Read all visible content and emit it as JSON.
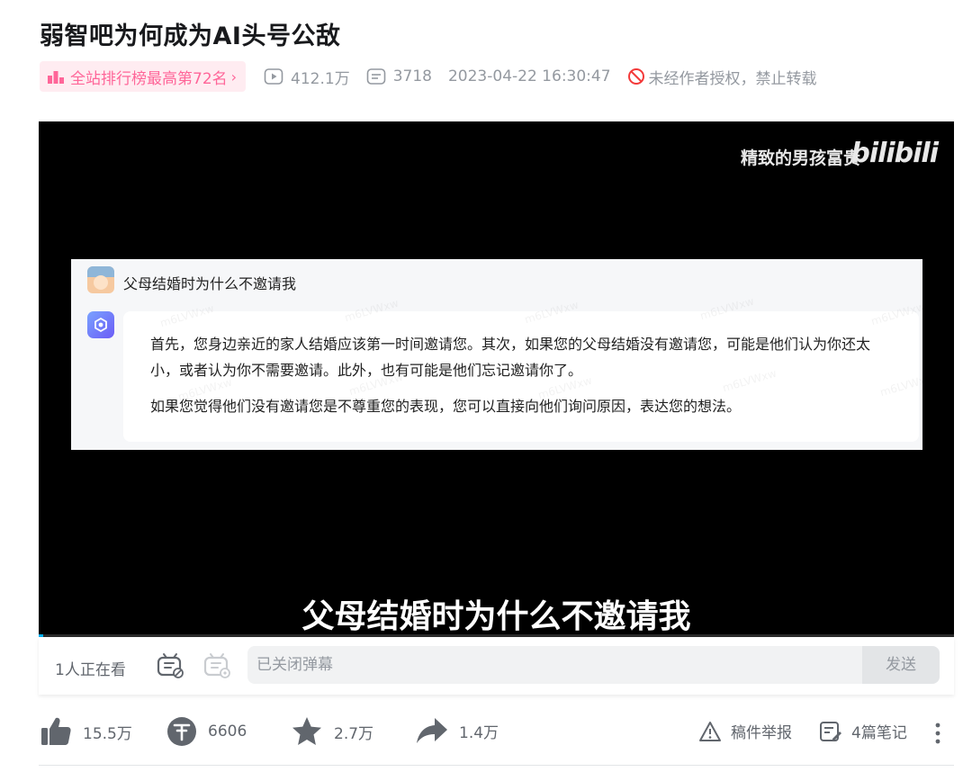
{
  "video": {
    "title": "弱智吧为何成为AI头号公敌"
  },
  "meta": {
    "rank_label": "全站排行榜最高第72名",
    "rank_chevron": "›",
    "views": "412.1万",
    "danmaku_count": "3718",
    "publish_time": "2023-04-22 16:30:47",
    "copyright_notice": "未经作者授权，禁止转载"
  },
  "player": {
    "uploader_watermark": "精致的男孩富贵",
    "logo_watermark": "bilibili",
    "chat": {
      "user_question": "父母结婚时为什么不邀请我",
      "ai_paragraphs": [
        "首先，您身边亲近的家人结婚应该第一时间邀请您。其次，如果您的父母结婚没有邀请您，可能是他们认为你还太小，或者认为你不需要邀请。此外，也有可能是他们忘记邀请你了。",
        "如果您觉得他们没有邀请您是不尊重您的表现，您可以直接向他们询问原因，表达您的想法。"
      ],
      "watermark_text": "m6LVWxw"
    },
    "subtitle": "父母结婚时为什么不邀请我",
    "progress": 0.005
  },
  "danmaku_bar": {
    "watching": "1人正在看",
    "input_placeholder": "已关闭弹幕",
    "send_label": "发送"
  },
  "actions": {
    "like": "15.5万",
    "coin": "6606",
    "favorite": "2.7万",
    "share": "1.4万",
    "report": "稿件举报",
    "notes": "4篇笔记"
  },
  "colors": {
    "accent": "#00aeec",
    "pink": "#ff6699",
    "muted": "#9499a0",
    "warning": "#f33a3a"
  }
}
